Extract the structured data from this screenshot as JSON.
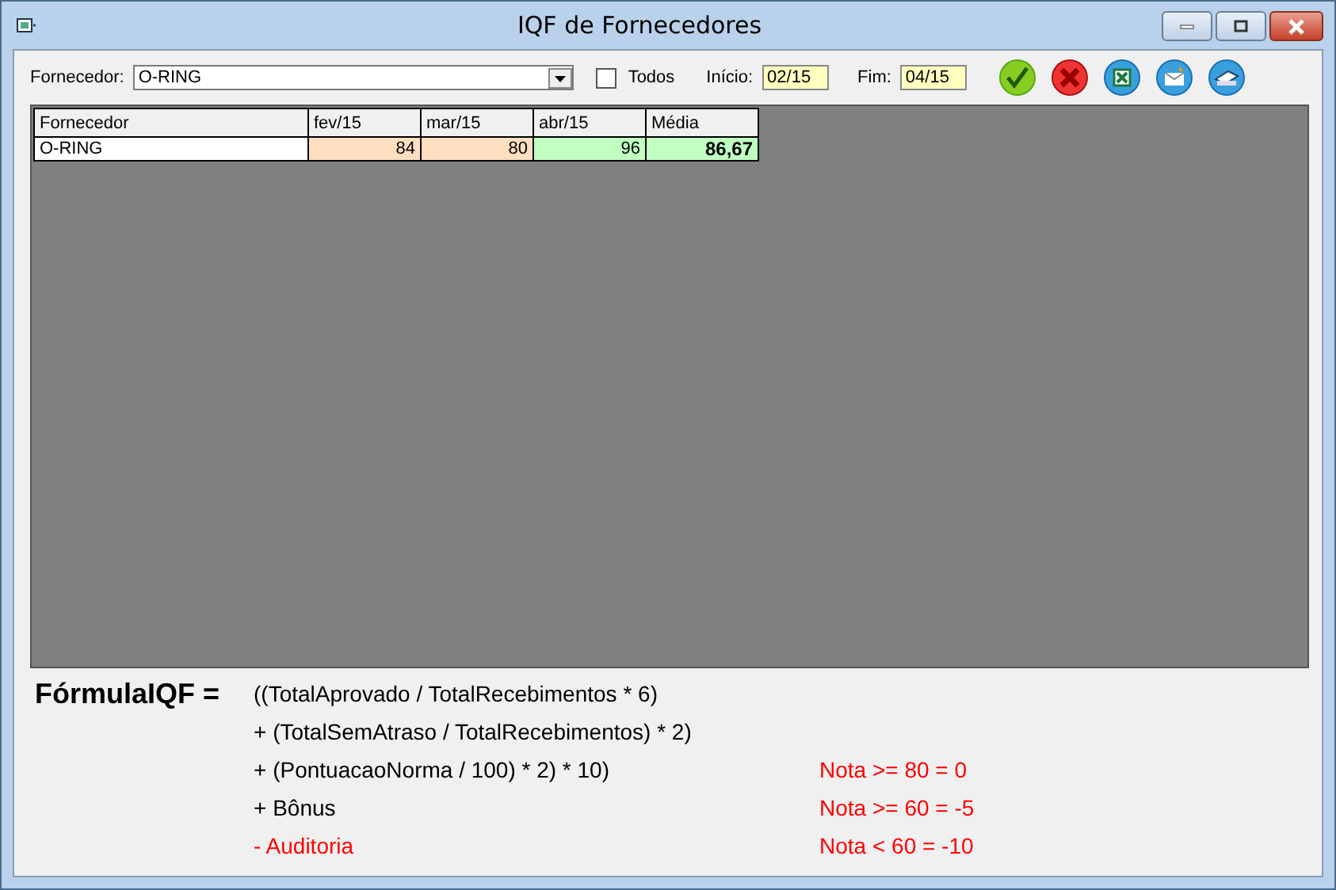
{
  "window": {
    "title": "IQF de Fornecedores"
  },
  "filter": {
    "supplier_label": "Fornecedor:",
    "supplier_value": "O-RING",
    "all_label": "Todos",
    "all_checked": false,
    "start_label": "Início:",
    "start_value": "02/15",
    "end_label": "Fim:",
    "end_value": "04/15"
  },
  "toolbar": [
    {
      "kind": "confirm"
    },
    {
      "kind": "cancel"
    },
    {
      "kind": "excel"
    },
    {
      "kind": "email"
    },
    {
      "kind": "print"
    }
  ],
  "grid": {
    "columns": [
      "Fornecedor",
      "fev/15",
      "mar/15",
      "abr/15",
      "Média"
    ],
    "rows": [
      {
        "cells": [
          {
            "text": "O-RING"
          },
          {
            "text": "84",
            "color": "#ffdfc0"
          },
          {
            "text": "80",
            "color": "#ffdfc0"
          },
          {
            "text": "96",
            "color": "#c0ffc0"
          },
          {
            "text": "86,67",
            "color": "#c0ffc0",
            "bold": true
          }
        ]
      }
    ]
  },
  "formula": {
    "label": "FórmulaIQF =",
    "lines": [
      {
        "text": "((TotalAprovado / TotalRecebimentos * 6)",
        "negative": false
      },
      {
        "text": "+ (TotalSemAtraso / TotalRecebimentos) * 2)",
        "negative": false
      },
      {
        "text": "+ (PontuacaoNorma / 100) * 2) * 10)",
        "negative": false,
        "note": "Nota >= 80 = 0"
      },
      {
        "text": "+ Bônus",
        "negative": false,
        "note": "Nota >= 60 = -5"
      },
      {
        "text": "- Auditoria",
        "negative": true,
        "note": "Nota < 60 = -10"
      }
    ]
  }
}
